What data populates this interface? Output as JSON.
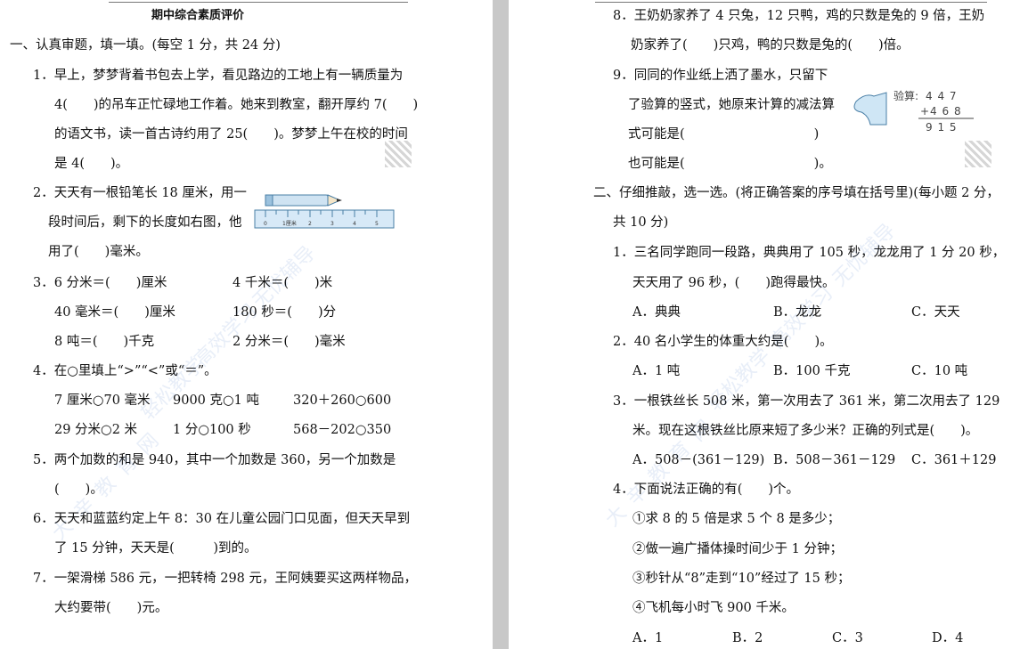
{
  "title": "期中综合素质评价",
  "left": {
    "section1_heading": "一、认真审题，填一填。(每空 1 分，共 24 分)",
    "q1": [
      "1．早上，梦梦背着书包去上学，看见路边的工地上有一辆质量为",
      "4(　　)的吊车正忙碌地工作着。她来到教室，翻开厚约 7(　　)",
      "的语文书，读一首古诗约用了 25(　　)。梦梦上午在校的时间",
      "是 4(　　)。"
    ],
    "q2": [
      "2．天天有一根铅笔长 18 厘米，用一",
      "段时间后，剩下的长度如右图，他",
      "用了(　　)毫米。"
    ],
    "ruler_labels": [
      "0",
      "1厘米",
      "2",
      "3",
      "4",
      "5"
    ],
    "q3": [
      "3．6 分米＝(　　)厘米",
      "4 千米＝(　　)米",
      "40 毫米＝(　　)厘米",
      "180 秒＝(　　)分",
      "8 吨＝(　　)千克",
      "2 分米＝(　　)毫米"
    ],
    "q4": [
      "4．在○里填上“>”“<”或“＝”。",
      "7 厘米○70 毫米",
      "9000 克○1 吨",
      "320＋260○600",
      "29 分米○2 米",
      "1 分○100 秒",
      "568－202○350"
    ],
    "q5": [
      "5．两个加数的和是 940，其中一个加数是 360，另一个加数是",
      "(　　)。"
    ],
    "q6": [
      "6．天天和蓝蓝约定上午 8：30 在儿童公园门口见面，但天天早到",
      "了 15 分钟，天天是(　　　)到的。"
    ],
    "q7": [
      "7．一架滑梯 586 元，一把转椅 298 元，王阿姨要买这两样物品，",
      "大约要带(　　)元。"
    ]
  },
  "right": {
    "q8": [
      "8．王奶奶家养了 4 只兔，12 只鸭，鸡的只数是兔的 9 倍，王奶",
      "奶家养了(　　)只鸡，鸭的只数是兔的(　　)倍。"
    ],
    "q9": [
      "9．同同的作业纸上洒了墨水，只留下",
      "了验算的竖式，她原来计算的减法算",
      "式可能是(　　　　　　　　　　)",
      "也可能是(　　　　　　　　　　)。"
    ],
    "check_label": "验算:",
    "check_rows": [
      "4 4 7",
      "+4 6 8",
      "9 1 5"
    ],
    "section2_heading": [
      "二、仔细推敲，选一选。(将正确答案的序号填在括号里)(每小题 2 分，",
      "共 10 分)"
    ],
    "s2q1": [
      "1．三名同学跑同一段路，典典用了 105 秒，龙龙用了 1 分 20 秒，",
      "天天用了 96 秒，(　　)跑得最快。",
      "A．典典",
      "B．龙龙",
      "C．天天"
    ],
    "s2q2": [
      "2．40 名小学生的体重大约是(　　)。",
      "A．1 吨",
      "B．100 千克",
      "C．10 吨"
    ],
    "s2q3": [
      "3．一根铁丝长 508 米，第一次用去了 361 米，第二次用去了 129",
      "米。现在这根铁丝比原来短了多少米？正确的列式是(　　)。",
      "A．508－(361－129)",
      "B．508－361－129",
      "C．361＋129"
    ],
    "s2q4": [
      "4．下面说法正确的有(　　)个。",
      "①求 8 的 5 倍是求 5 个 8 是多少；",
      "②做一遍广播体操时间少于 1 分钟；",
      "③秒针从“8”走到“10”经过了 15 秒；",
      "④飞机每小时飞 900 千米。",
      "A．1",
      "B．2",
      "C．3",
      "D．4"
    ]
  },
  "watermark": [
    "大",
    "辛",
    "教",
    "育",
    "网",
    "轻松教学",
    "高效学习",
    "无忧辅导"
  ]
}
